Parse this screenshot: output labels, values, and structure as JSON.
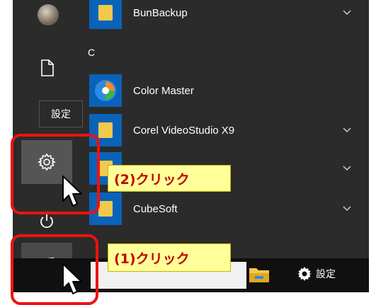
{
  "start_menu": {
    "settings_tooltip": "設定",
    "group_letter": "C",
    "apps": [
      {
        "label": "BunBackup",
        "icon": "folder-icon",
        "expandable": true
      },
      {
        "label": "Color Master",
        "icon": "color-master-icon",
        "expandable": false
      },
      {
        "label": "Corel VideoStudio X9",
        "icon": "folder-icon",
        "expandable": true
      },
      {
        "label": "",
        "icon": "folder-icon",
        "expandable": true
      },
      {
        "label": "CubeSoft",
        "icon": "folder-icon",
        "expandable": true
      }
    ]
  },
  "taskbar": {
    "settings_label": "設定"
  },
  "annotations": {
    "step2": "(2)クリック",
    "step1": "(1)クリック",
    "callout_background": "#ffff99",
    "callout_text_color": "#c00000",
    "highlight_color": "#ee1111"
  },
  "colors": {
    "menu_bg": "#2b2b2b",
    "tile_blue": "#0a63b8",
    "taskbar_bg": "#101010"
  }
}
